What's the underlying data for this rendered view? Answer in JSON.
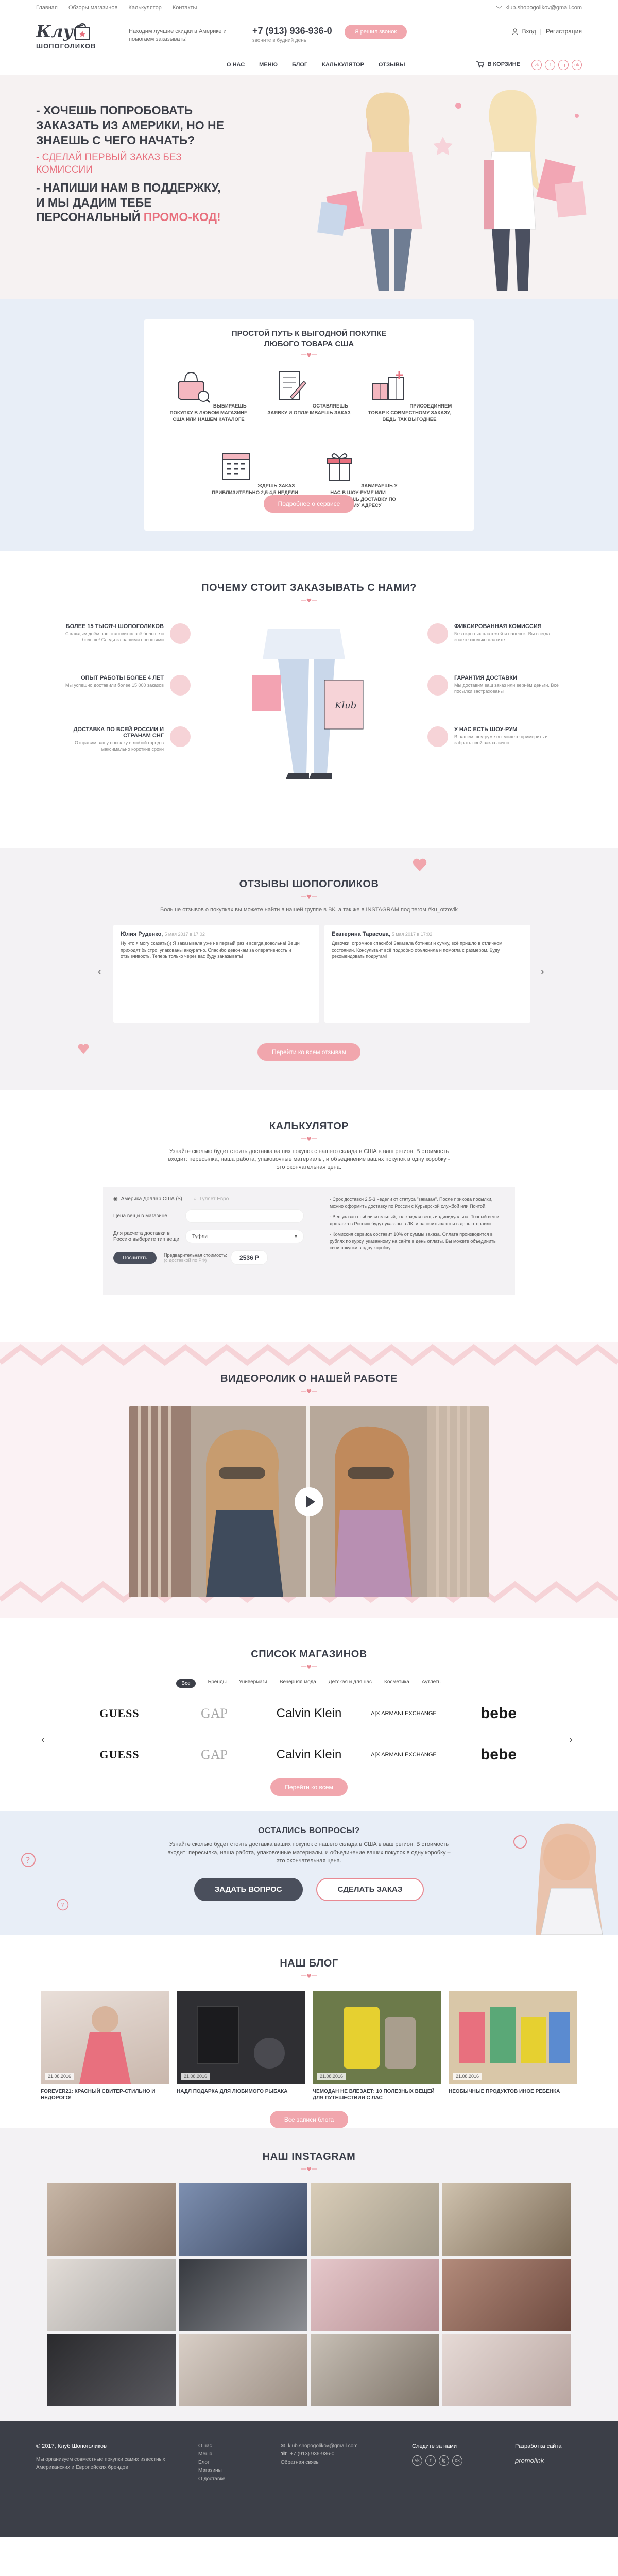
{
  "topbar": {
    "links": [
      "Главная",
      "Обзоры магазинов",
      "Калькулятор",
      "Контакты"
    ],
    "email": "klub.shopogolikov@gmail.com"
  },
  "header": {
    "logo_top": "Клуб",
    "logo_bottom": "ШОПОГОЛИКОВ",
    "slogan": "Находим лучшие скидки в Америке и помогаем заказывать!",
    "phone": "+7 (913) 936-936-0",
    "worktime": "звоните в будний день",
    "call_button": "Я решил звонок",
    "auth": "Вход",
    "register": "Регистрация",
    "nav": [
      "О НАС",
      "МЕНЮ",
      "БЛОГ",
      "КАЛЬКУЛЯТОР",
      "ОТЗЫВЫ"
    ],
    "cart": "В КОРЗИНЕ",
    "social": [
      "vk",
      "f",
      "ig",
      "ok"
    ]
  },
  "hero": {
    "line1": "- ХОЧЕШЬ ПОПРОБОВАТЬ ЗАКАЗАТЬ ИЗ АМЕРИКИ, НО НЕ ЗНАЕШЬ С ЧЕГО НАЧАТЬ?",
    "line2": "- СДЕЛАЙ ПЕРВЫЙ ЗАКАЗ БЕЗ КОМИССИИ",
    "line3a": "- НАПИШИ НАМ В ПОДДЕРЖКУ, И МЫ ДАДИМ ТЕБЕ ПЕРСОНАЛЬНЫЙ",
    "line3b": "ПРОМО-КОД!"
  },
  "steps": {
    "title": "ПРОСТОЙ ПУТЬ К ВЫГОДНОЙ ПОКУПКЕ ЛЮБОГО ТОВАРА США",
    "items": [
      "ВЫБИРАЕШЬ ПОКУПКУ В ЛЮБОМ МАГАЗИНЕ США ИЛИ НАШЕМ КАТАЛОГЕ",
      "ОСТАВЛЯЕШЬ ЗАЯВКУ И ОПЛАЧИВАЕШЬ ЗАКАЗ",
      "ПРИСОЕДИНЯЕМ ТОВАР К СОВМЕСТНОМУ ЗАКАЗУ, ВЕДЬ ТАК ВЫГОДНЕЕ",
      "ЖДЕШЬ ЗАКАЗ ПРИБЛИЗИТЕЛЬНО 2,5-4,5 НЕДЕЛИ",
      "ЗАБИРАЕШЬ У НАС В ШОУ-РУМЕ ИЛИ ЗАКАЗЫВАЕШЬ ДОСТАВКУ ПО НУЖНОМУ АДРЕСУ"
    ],
    "button": "Подробнее о сервисе"
  },
  "why": {
    "title": "ПОЧЕМУ СТОИТ ЗАКАЗЫВАТЬ С НАМИ?",
    "left": [
      {
        "title": "БОЛЕЕ 15 ТЫСЯЧ ШОПОГОЛИКОВ",
        "text": "С каждым днём нас становится всё больше и больше! Следи за нашими новостями"
      },
      {
        "title": "ОПЫТ РАБОТЫ БОЛЕЕ 4 ЛЕТ",
        "text": "Мы успешно доставили более 15 000 заказов"
      },
      {
        "title": "ДОСТАВКА ПО ВСЕЙ РОССИИ И СТРАНАМ СНГ",
        "text": "Отправим вашу посылку в любой город в максимально короткие сроки"
      }
    ],
    "right": [
      {
        "title": "ФИКСИРОВАННАЯ КОМИССИЯ",
        "text": "Без скрытых платежей и наценок. Вы всегда знаете сколько платите"
      },
      {
        "title": "ГАРАНТИЯ ДОСТАВКИ",
        "text": "Мы доставим ваш заказ или вернём деньги. Всё посылки застрахованы"
      },
      {
        "title": "У НАС ЕСТЬ ШОУ-РУМ",
        "text": "В нашем шоу-руме вы можете примерить и забрать свой заказ лично"
      }
    ]
  },
  "reviews": {
    "title": "ОТЗЫВЫ ШОПОГОЛИКОВ",
    "subtitle": "Больше отзывов о покупках вы можете найти в нашей группе в ВК, а так же в INSTAGRAM под тегом #ku_otzovik",
    "cards": [
      {
        "name": "Юлия Руденко,",
        "date": "5 мая 2017 в 17:02",
        "text": "Ну что я могу сказать))) Я заказывала уже не первый раз и всегда довольна! Вещи приходят быстро, упакованы аккуратно. Спасибо девочкам за оперативность и отзывчивость. Теперь только через вас буду заказывать!"
      },
      {
        "name": "Екатерина Тарасова,",
        "date": "5 мая 2017 в 17:02",
        "text": "Девочки, огромное спасибо! Заказала ботинки и сумку, всё пришло в отличном состоянии. Консультант всё подробно объяснила и помогла с размером. Буду рекомендовать подругам!"
      }
    ],
    "button": "Перейти ко всем отзывам"
  },
  "calc": {
    "title": "КАЛЬКУЛЯТОР",
    "desc": "Узнайте сколько будет стоить доставка ваших покупок с нашего склада в США в ваш регион. В стоимость входит: пересылка, наша работа, упаковочные материалы, и объединение ваших покупок в одну коробку - это окончательная цена.",
    "currency1": "Америка Доллар США ($)",
    "currency2": "Гуляет Евро",
    "price_label": "Цена вещи в магазине",
    "delivery_label": "Для расчета доставки в Россию выберите тип вещи",
    "select_value": "Туфли",
    "button": "Посчитать",
    "result_label": "Предварительная стоимость:",
    "result_note": "(с доставкой по РФ)",
    "result_value": "2536 Р",
    "notes": [
      "- Срок доставки 2,5-3 недели от статуса \"заказан\". После прихода посылки, можно оформить доставку по России с Курьерской службой или Почтой.",
      "- Вес указан приблизительный, т.к. каждая вещь индивидуальна. Точный вес и доставка в Россию будут указаны в ЛК, и рассчитываются в день отправки.",
      "- Комиссия сервиса составит 10% от суммы заказа. Оплата производится в рублях по курсу, указанному на сайте в день оплаты. Вы можете объединить свои покупки в одну коробку."
    ]
  },
  "video": {
    "title": "ВИДЕОРОЛИК О НАШЕЙ РАБОТЕ"
  },
  "stores": {
    "title": "СПИСОК МАГАЗИНОВ",
    "tabs": [
      "Все",
      "Бренды",
      "Универмаги",
      "Вечерняя мода",
      "Детская и для нас",
      "Косметика",
      "Аутлеты"
    ],
    "brands": [
      "GUESS",
      "GAP",
      "Calvin Klein",
      "A|X ARMANI EXCHANGE",
      "bebe",
      "GUESS",
      "GAP",
      "Calvin Klein",
      "A|X ARMANI EXCHANGE",
      "bebe"
    ],
    "button": "Перейти ко всем"
  },
  "quest": {
    "title": "ОСТАЛИСЬ ВОПРОСЫ?",
    "text": "Узнайте сколько будет стоить доставка ваших покупок с нашего склада в США в ваш регион. В стоимость входит: пересылка, наша работа, упаковочные материалы, и объединение ваших покупок в одну коробку – это окончательная цена.",
    "btn_ask": "ЗАДАТЬ ВОПРОС",
    "btn_order": "СДЕЛАТЬ ЗАКАЗ"
  },
  "blog": {
    "title": "НАШ БЛОГ",
    "posts": [
      {
        "date": "21.08.2016",
        "title": "FOREVER21: КРАСНЫЙ СВИТЕР-СТИЛЬНО И НЕДОРОГО!"
      },
      {
        "date": "21.08.2016",
        "title": "НАДЛ ПОДАРКА ДЛЯ ЛЮБИМОГО РЫБАКА"
      },
      {
        "date": "21.08.2016",
        "title": "ЧЕМОДАН НЕ ВЛЕЗАЕТ: 10 ПОЛЕЗНЫХ ВЕЩЕЙ ДЛЯ ПУТЕШЕСТВИЯ С ЛАС"
      },
      {
        "date": "21.08.2016",
        "title": "НЕОБЫЧНЫЕ ПРОДУКТОВ ИНОЕ РЕБЕНКА"
      }
    ],
    "button": "Все записи блога"
  },
  "insta": {
    "title": "НАШ INSTAGRAM"
  },
  "footer": {
    "copy": "© 2017, Клуб Шопоголиков",
    "about": "Мы организуем совместные покупки самих известных Американских и Европейских брендов",
    "nav": [
      "О нас",
      "Меню",
      "Блог",
      "Магазины",
      "О доставке"
    ],
    "email": "klub.shopogolikov@gmail.com",
    "phone": "+7 (913) 936-936-0",
    "order": "Обратная связь",
    "follow": "Следите за нами",
    "dev": "Разработка сайта",
    "dev_name": "promolink"
  },
  "colors": {
    "accent": "#f1a6ad",
    "pink_text": "#e8707e",
    "dark": "#3c3f48",
    "blue_bg": "#e8eef7",
    "grey_bg": "#f3f2f4"
  }
}
